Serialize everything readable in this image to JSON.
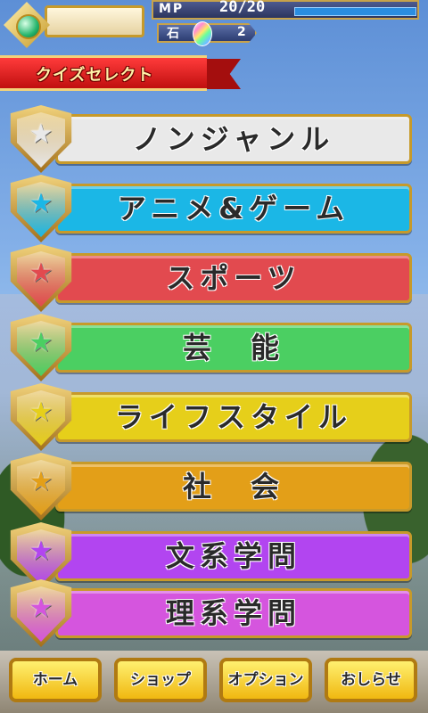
{
  "status": {
    "mp_label": "MP",
    "mp_value": "20/20",
    "stone_label": "石",
    "stone_count": "2"
  },
  "ribbon": {
    "title": "クイズセレクト"
  },
  "genres": [
    {
      "label": "ノンジャンル",
      "color": "#e9e9e9"
    },
    {
      "label": "アニメ&ゲーム",
      "color": "#1bb7e6"
    },
    {
      "label": "スポーツ",
      "color": "#e24a4f"
    },
    {
      "label": "芸　能",
      "color": "#4bcf62"
    },
    {
      "label": "ライフスタイル",
      "color": "#e6cf1a"
    },
    {
      "label": "社　会",
      "color": "#e39f18"
    },
    {
      "label": "文系学問",
      "color": "#b245f0"
    },
    {
      "label": "理系学問",
      "color": "#d555de"
    }
  ],
  "nav": {
    "home": "ホーム",
    "shop": "ショップ",
    "option": "オプション",
    "news": "おしらせ"
  }
}
